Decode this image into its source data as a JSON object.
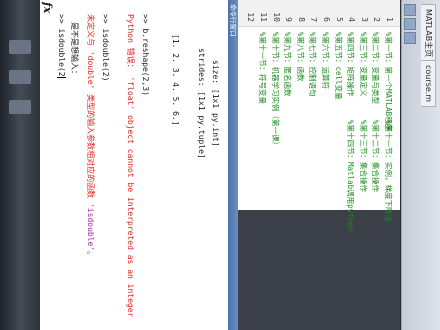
{
  "tabs": [
    "MATLAB主页",
    "course.m"
  ],
  "status_label": "命令行窗口",
  "editor_lines": [
    {
      "no": "1",
      "text": "%第一节：第一个MATLAB程序"
    },
    {
      "no": "2",
      "text": "%第二节：变量与类型"
    },
    {
      "no": "3",
      "text": "%第三节：变量定义"
    },
    {
      "no": "4",
      "text": "%第四节：矩阵操作"
    },
    {
      "no": "5",
      "text": "%第五节：cell变量"
    },
    {
      "no": "6",
      "text": "%第六节：运算符"
    },
    {
      "no": "7",
      "text": "%第七节：控制语句"
    },
    {
      "no": "8",
      "text": "%第八节：函数"
    },
    {
      "no": "9",
      "text": "%第九节：匿名函数"
    },
    {
      "no": "10",
      "text": "%第十节：机器学习实例（第一课）"
    },
    {
      "no": "11",
      "text": "%第十一节：符号变量"
    },
    {
      "no": "12",
      "text": ""
    }
  ],
  "editor_lines_right": [
    "%第十一节：实例，梯度下降法",
    "%第十二节：集合操作",
    "%第十三节：集合操作",
    "%第十四节：Matlab调用python"
  ],
  "command": {
    "size_line": "size: [1x1 py.int]",
    "strides_line": "strides: [1x1 py.tuple]",
    "array_line": "[1.  2.  3.  4.  5.  6.]",
    "reshape_line": ">> b.reshape(2,3)",
    "error_prefix": "Python 错误：",
    "error_text": " 'float' object cannot be interpreted as an integer",
    "isdouble_line": ">> isdouble(2)",
    "undef_prefix": "未定义与 'double' 类型的输入参数相对应的函数 ",
    "undef_func": "'isdouble'",
    "undef_suffix": "。",
    "hint_line": "是不是想输入：",
    "prompt_line": ">> isdouble(2",
    "fx_label": "fx"
  }
}
